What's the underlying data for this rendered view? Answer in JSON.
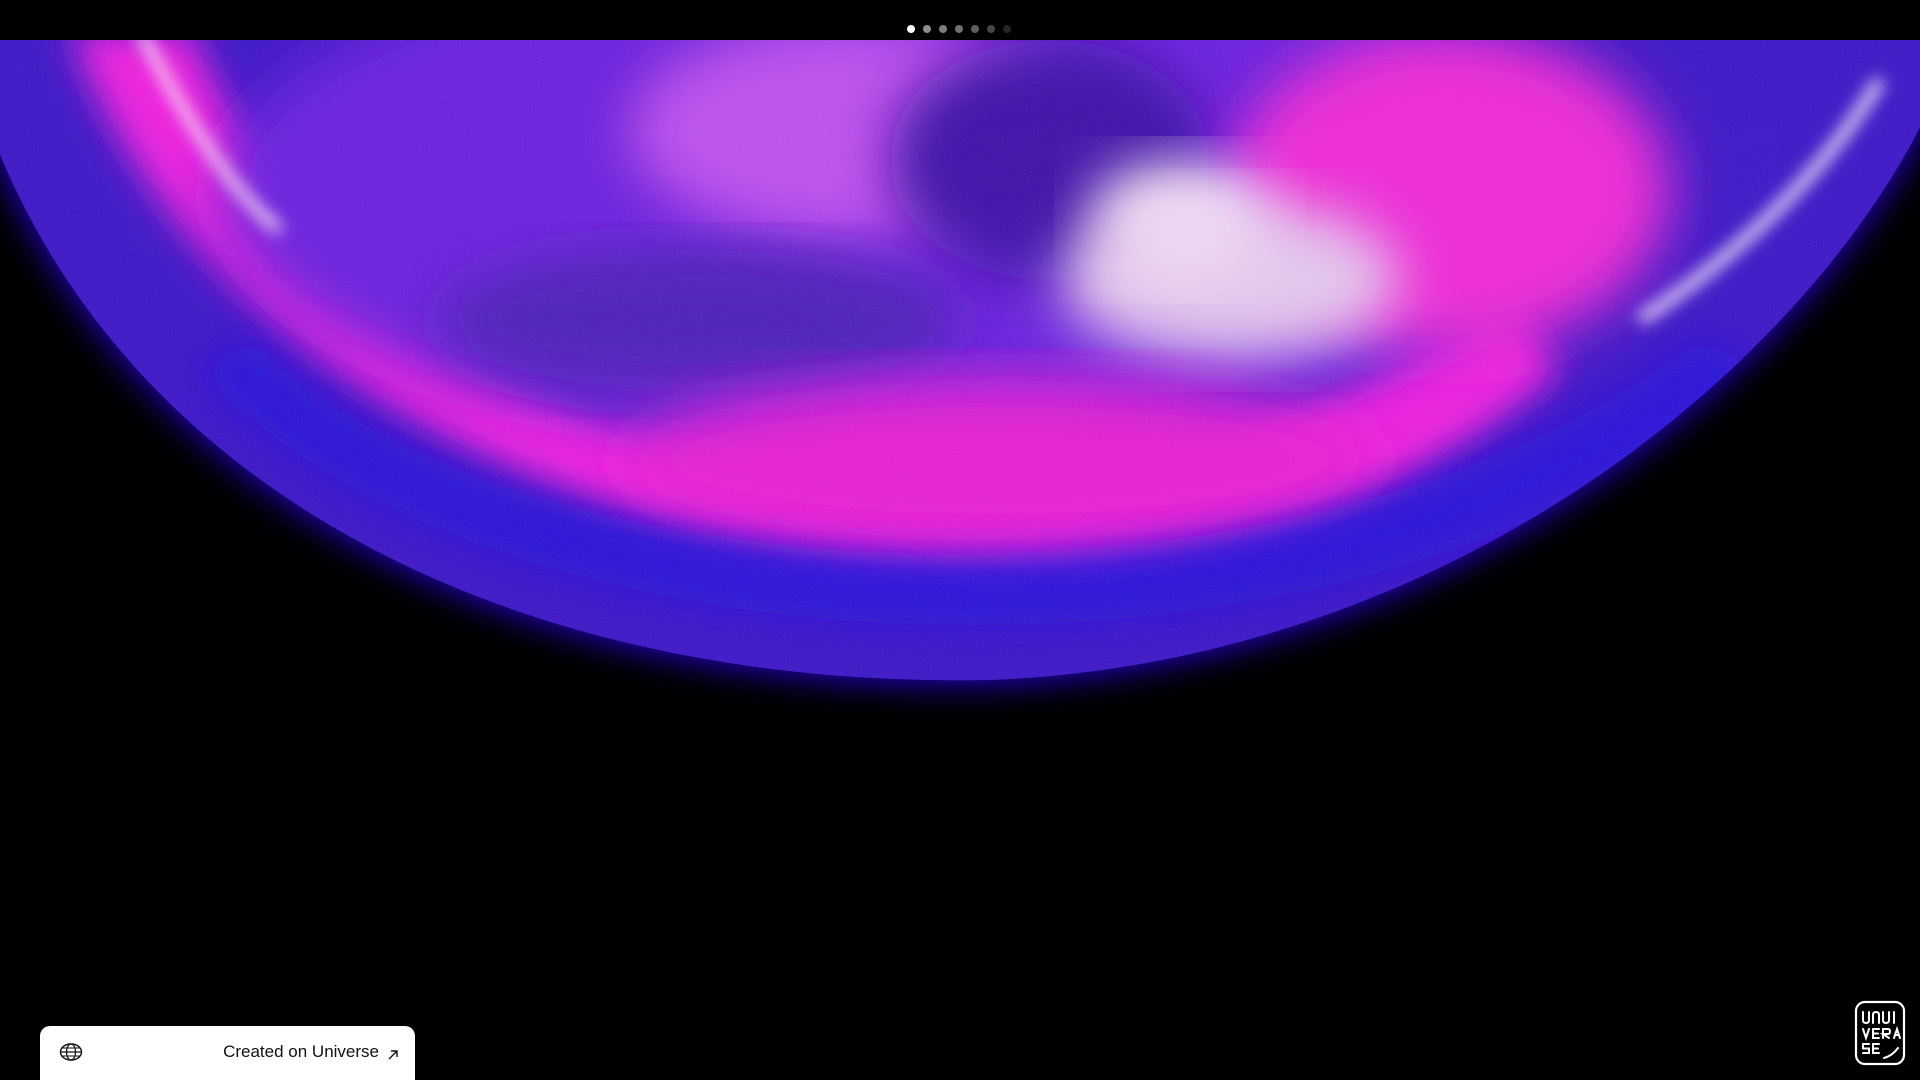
{
  "pagination": {
    "dots": [
      {
        "state": "active"
      },
      {
        "state": "inactive"
      },
      {
        "state": "inactive"
      },
      {
        "state": "inactive"
      },
      {
        "state": "inactive"
      },
      {
        "state": "inactive"
      },
      {
        "state": "inactive"
      }
    ],
    "current_page": 1,
    "total_pages": 7
  },
  "hero": {
    "colors": {
      "background": "#000000",
      "blue": "#2a10e8",
      "magenta": "#f01ce0",
      "violet": "#8a2be2",
      "lavender": "#e6c8f0"
    }
  },
  "badge": {
    "icon": "globe-icon",
    "label": "Created on Universe",
    "link_icon": "arrow-up-right-icon"
  },
  "logo": {
    "icon": "universe-logo-icon"
  }
}
